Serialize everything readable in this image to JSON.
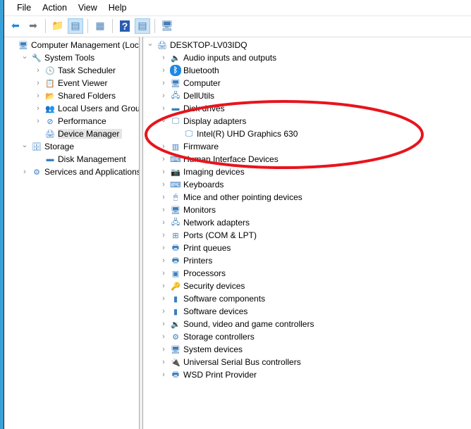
{
  "menu": [
    "File",
    "Action",
    "View",
    "Help"
  ],
  "toolbar": [
    {
      "icon": "back-arrow-icon",
      "glyph": "⬅"
    },
    {
      "icon": "forward-arrow-icon",
      "glyph": "➡"
    },
    {
      "icon": "up-folder-icon",
      "glyph": "📁"
    },
    {
      "icon": "show-hide-console-tree-icon",
      "glyph": "▤"
    },
    {
      "icon": "properties-icon",
      "glyph": "▦"
    },
    {
      "icon": "help-icon",
      "glyph": "?"
    },
    {
      "icon": "show-hide-action-pane-icon",
      "glyph": "▤"
    },
    {
      "icon": "scan-hardware-icon",
      "glyph": "🖥"
    }
  ],
  "left_tree": [
    {
      "label": "Computer Management (Local",
      "level": 0,
      "chev": "",
      "icon": "computer-management-icon",
      "glyph": "🖥"
    },
    {
      "label": "System Tools",
      "level": 1,
      "chev": "⌄",
      "icon": "tools-icon",
      "glyph": "🔧"
    },
    {
      "label": "Task Scheduler",
      "level": 2,
      "chev": "›",
      "icon": "clock-icon",
      "glyph": "🕓"
    },
    {
      "label": "Event Viewer",
      "level": 2,
      "chev": "›",
      "icon": "event-viewer-icon",
      "glyph": "📋"
    },
    {
      "label": "Shared Folders",
      "level": 2,
      "chev": "›",
      "icon": "shared-folder-icon",
      "glyph": "📂"
    },
    {
      "label": "Local Users and Groups",
      "level": 2,
      "chev": "›",
      "icon": "users-icon",
      "glyph": "👥"
    },
    {
      "label": "Performance",
      "level": 2,
      "chev": "›",
      "icon": "performance-icon",
      "glyph": "⊘"
    },
    {
      "label": "Device Manager",
      "level": 2,
      "chev": "",
      "icon": "device-manager-icon",
      "glyph": "🖨",
      "selected": true
    },
    {
      "label": "Storage",
      "level": 1,
      "chev": "⌄",
      "icon": "storage-icon",
      "glyph": "🗄"
    },
    {
      "label": "Disk Management",
      "level": 2,
      "chev": "",
      "icon": "disk-icon",
      "glyph": "▬"
    },
    {
      "label": "Services and Applications",
      "level": 1,
      "chev": "›",
      "icon": "services-icon",
      "glyph": "⚙"
    }
  ],
  "right_tree": [
    {
      "label": "DESKTOP-LV03IDQ",
      "level": 0,
      "chev": "⌄",
      "icon": "computer-icon",
      "glyph": "🖨"
    },
    {
      "label": "Audio inputs and outputs",
      "level": 1,
      "chev": "›",
      "icon": "speaker-icon",
      "glyph": "🔈"
    },
    {
      "label": "Bluetooth",
      "level": 1,
      "chev": "›",
      "icon": "bluetooth-icon",
      "glyph": "ᛒ"
    },
    {
      "label": "Computer",
      "level": 1,
      "chev": "›",
      "icon": "monitor-icon",
      "glyph": "🖥"
    },
    {
      "label": "DellUtils",
      "level": 1,
      "chev": "›",
      "icon": "network-computer-icon",
      "glyph": "🖧"
    },
    {
      "label": "Disk drives",
      "level": 1,
      "chev": "›",
      "icon": "disk-drive-icon",
      "glyph": "▬"
    },
    {
      "label": "Display adapters",
      "level": 1,
      "chev": "⌄",
      "icon": "display-adapter-icon",
      "glyph": "🖵"
    },
    {
      "label": "Intel(R) UHD Graphics 630",
      "level": 2,
      "chev": "",
      "icon": "display-adapter-icon",
      "glyph": "🖵"
    },
    {
      "label": "Firmware",
      "level": 1,
      "chev": "›",
      "icon": "firmware-chip-icon",
      "glyph": "▥"
    },
    {
      "label": "Human Interface Devices",
      "level": 1,
      "chev": "›",
      "icon": "hid-icon",
      "glyph": "⌨"
    },
    {
      "label": "Imaging devices",
      "level": 1,
      "chev": "›",
      "icon": "camera-icon",
      "glyph": "📷"
    },
    {
      "label": "Keyboards",
      "level": 1,
      "chev": "›",
      "icon": "keyboard-icon",
      "glyph": "⌨"
    },
    {
      "label": "Mice and other pointing devices",
      "level": 1,
      "chev": "›",
      "icon": "mouse-icon",
      "glyph": "🖱"
    },
    {
      "label": "Monitors",
      "level": 1,
      "chev": "›",
      "icon": "monitor-icon",
      "glyph": "🖥"
    },
    {
      "label": "Network adapters",
      "level": 1,
      "chev": "›",
      "icon": "network-adapter-icon",
      "glyph": "🖧"
    },
    {
      "label": "Ports (COM & LPT)",
      "level": 1,
      "chev": "›",
      "icon": "port-icon",
      "glyph": "⊞"
    },
    {
      "label": "Print queues",
      "level": 1,
      "chev": "›",
      "icon": "printer-icon",
      "glyph": "🖶"
    },
    {
      "label": "Printers",
      "level": 1,
      "chev": "›",
      "icon": "printer-icon",
      "glyph": "🖶"
    },
    {
      "label": "Processors",
      "level": 1,
      "chev": "›",
      "icon": "processor-icon",
      "glyph": "▣"
    },
    {
      "label": "Security devices",
      "level": 1,
      "chev": "›",
      "icon": "security-device-icon",
      "glyph": "🔑"
    },
    {
      "label": "Software components",
      "level": 1,
      "chev": "›",
      "icon": "software-component-icon",
      "glyph": "▮"
    },
    {
      "label": "Software devices",
      "level": 1,
      "chev": "›",
      "icon": "software-device-icon",
      "glyph": "▮"
    },
    {
      "label": "Sound, video and game controllers",
      "level": 1,
      "chev": "›",
      "icon": "sound-icon",
      "glyph": "🔉"
    },
    {
      "label": "Storage controllers",
      "level": 1,
      "chev": "›",
      "icon": "storage-controller-icon",
      "glyph": "⚙"
    },
    {
      "label": "System devices",
      "level": 1,
      "chev": "›",
      "icon": "system-device-icon",
      "glyph": "🖥"
    },
    {
      "label": "Universal Serial Bus controllers",
      "level": 1,
      "chev": "›",
      "icon": "usb-icon",
      "glyph": "🔌"
    },
    {
      "label": "WSD Print Provider",
      "level": 1,
      "chev": "›",
      "icon": "wsd-printer-icon",
      "glyph": "🖶"
    }
  ],
  "annotation_color": "#e8141c"
}
